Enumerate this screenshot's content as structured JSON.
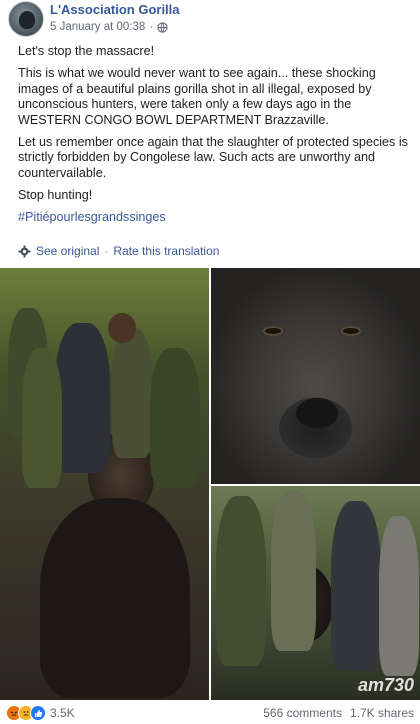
{
  "header": {
    "page_name": "L'Association Gorilla",
    "timestamp": "5 January at 00:38",
    "separator": "·",
    "audience_icon": "globe-icon"
  },
  "post": {
    "paragraphs": [
      "Let's stop the massacre!",
      "This is what we would never want to see again... these shocking images of a beautiful plains gorilla shot in all illegal, exposed by unconscious hunters, were taken only a few days ago in the WESTERN CONGO BOWL DEPARTMENT Brazzaville.",
      "Let us remember once again that the slaughter of protected species is strictly forbidden by Congolese law. Such acts are unworthy and countervailable.",
      "Stop hunting!"
    ],
    "hashtag": "#Pitiépourlesgrandssinges"
  },
  "translation": {
    "icon": "gear-icon",
    "see_original": "See original",
    "separator": "·",
    "rate": "Rate this translation"
  },
  "photos": {
    "watermark": "am730"
  },
  "footer": {
    "reaction_icons": [
      "angry-icon",
      "sad-icon",
      "like-icon"
    ],
    "reaction_count": "3.5K",
    "comments": "566 comments",
    "shares": "1.7K shares"
  },
  "colors": {
    "link": "#385898",
    "text": "#1c1e21",
    "meta": "#616770",
    "angry": "#e9710f",
    "sad": "#f7b125",
    "like": "#2078f4"
  }
}
